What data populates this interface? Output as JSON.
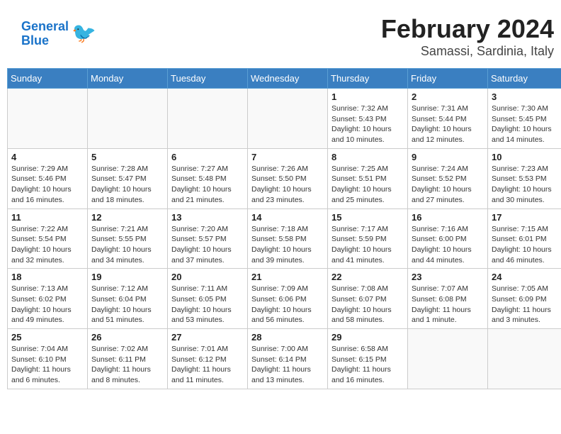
{
  "header": {
    "logo_line1": "General",
    "logo_line2": "Blue",
    "month_year": "February 2024",
    "location": "Samassi, Sardinia, Italy"
  },
  "days_of_week": [
    "Sunday",
    "Monday",
    "Tuesday",
    "Wednesday",
    "Thursday",
    "Friday",
    "Saturday"
  ],
  "weeks": [
    [
      {
        "day": "",
        "info": ""
      },
      {
        "day": "",
        "info": ""
      },
      {
        "day": "",
        "info": ""
      },
      {
        "day": "",
        "info": ""
      },
      {
        "day": "1",
        "info": "Sunrise: 7:32 AM\nSunset: 5:43 PM\nDaylight: 10 hours\nand 10 minutes."
      },
      {
        "day": "2",
        "info": "Sunrise: 7:31 AM\nSunset: 5:44 PM\nDaylight: 10 hours\nand 12 minutes."
      },
      {
        "day": "3",
        "info": "Sunrise: 7:30 AM\nSunset: 5:45 PM\nDaylight: 10 hours\nand 14 minutes."
      }
    ],
    [
      {
        "day": "4",
        "info": "Sunrise: 7:29 AM\nSunset: 5:46 PM\nDaylight: 10 hours\nand 16 minutes."
      },
      {
        "day": "5",
        "info": "Sunrise: 7:28 AM\nSunset: 5:47 PM\nDaylight: 10 hours\nand 18 minutes."
      },
      {
        "day": "6",
        "info": "Sunrise: 7:27 AM\nSunset: 5:48 PM\nDaylight: 10 hours\nand 21 minutes."
      },
      {
        "day": "7",
        "info": "Sunrise: 7:26 AM\nSunset: 5:50 PM\nDaylight: 10 hours\nand 23 minutes."
      },
      {
        "day": "8",
        "info": "Sunrise: 7:25 AM\nSunset: 5:51 PM\nDaylight: 10 hours\nand 25 minutes."
      },
      {
        "day": "9",
        "info": "Sunrise: 7:24 AM\nSunset: 5:52 PM\nDaylight: 10 hours\nand 27 minutes."
      },
      {
        "day": "10",
        "info": "Sunrise: 7:23 AM\nSunset: 5:53 PM\nDaylight: 10 hours\nand 30 minutes."
      }
    ],
    [
      {
        "day": "11",
        "info": "Sunrise: 7:22 AM\nSunset: 5:54 PM\nDaylight: 10 hours\nand 32 minutes."
      },
      {
        "day": "12",
        "info": "Sunrise: 7:21 AM\nSunset: 5:55 PM\nDaylight: 10 hours\nand 34 minutes."
      },
      {
        "day": "13",
        "info": "Sunrise: 7:20 AM\nSunset: 5:57 PM\nDaylight: 10 hours\nand 37 minutes."
      },
      {
        "day": "14",
        "info": "Sunrise: 7:18 AM\nSunset: 5:58 PM\nDaylight: 10 hours\nand 39 minutes."
      },
      {
        "day": "15",
        "info": "Sunrise: 7:17 AM\nSunset: 5:59 PM\nDaylight: 10 hours\nand 41 minutes."
      },
      {
        "day": "16",
        "info": "Sunrise: 7:16 AM\nSunset: 6:00 PM\nDaylight: 10 hours\nand 44 minutes."
      },
      {
        "day": "17",
        "info": "Sunrise: 7:15 AM\nSunset: 6:01 PM\nDaylight: 10 hours\nand 46 minutes."
      }
    ],
    [
      {
        "day": "18",
        "info": "Sunrise: 7:13 AM\nSunset: 6:02 PM\nDaylight: 10 hours\nand 49 minutes."
      },
      {
        "day": "19",
        "info": "Sunrise: 7:12 AM\nSunset: 6:04 PM\nDaylight: 10 hours\nand 51 minutes."
      },
      {
        "day": "20",
        "info": "Sunrise: 7:11 AM\nSunset: 6:05 PM\nDaylight: 10 hours\nand 53 minutes."
      },
      {
        "day": "21",
        "info": "Sunrise: 7:09 AM\nSunset: 6:06 PM\nDaylight: 10 hours\nand 56 minutes."
      },
      {
        "day": "22",
        "info": "Sunrise: 7:08 AM\nSunset: 6:07 PM\nDaylight: 10 hours\nand 58 minutes."
      },
      {
        "day": "23",
        "info": "Sunrise: 7:07 AM\nSunset: 6:08 PM\nDaylight: 11 hours\nand 1 minute."
      },
      {
        "day": "24",
        "info": "Sunrise: 7:05 AM\nSunset: 6:09 PM\nDaylight: 11 hours\nand 3 minutes."
      }
    ],
    [
      {
        "day": "25",
        "info": "Sunrise: 7:04 AM\nSunset: 6:10 PM\nDaylight: 11 hours\nand 6 minutes."
      },
      {
        "day": "26",
        "info": "Sunrise: 7:02 AM\nSunset: 6:11 PM\nDaylight: 11 hours\nand 8 minutes."
      },
      {
        "day": "27",
        "info": "Sunrise: 7:01 AM\nSunset: 6:12 PM\nDaylight: 11 hours\nand 11 minutes."
      },
      {
        "day": "28",
        "info": "Sunrise: 7:00 AM\nSunset: 6:14 PM\nDaylight: 11 hours\nand 13 minutes."
      },
      {
        "day": "29",
        "info": "Sunrise: 6:58 AM\nSunset: 6:15 PM\nDaylight: 11 hours\nand 16 minutes."
      },
      {
        "day": "",
        "info": ""
      },
      {
        "day": "",
        "info": ""
      }
    ]
  ]
}
